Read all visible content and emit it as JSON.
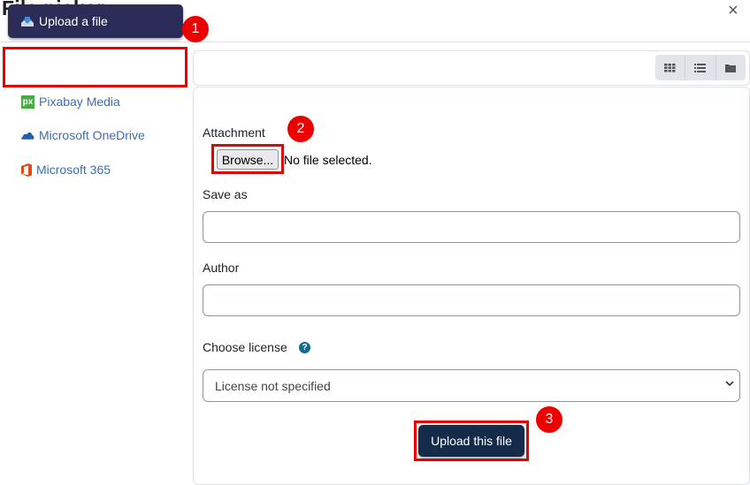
{
  "dialog": {
    "title": "File picker",
    "close_label": "×"
  },
  "sidebar": {
    "items": [
      {
        "label": "Upload a file",
        "icon": "upload-icon",
        "active": true
      },
      {
        "label": "Pixabay Media",
        "icon": "pixabay-icon"
      },
      {
        "label": "Microsoft OneDrive",
        "icon": "onedrive-icon"
      },
      {
        "label": "Microsoft 365",
        "icon": "office-icon"
      }
    ]
  },
  "toolbar": {
    "views": [
      {
        "name": "icons-view",
        "icon": "grid-icon"
      },
      {
        "name": "list-view",
        "icon": "list-icon"
      },
      {
        "name": "tree-view",
        "icon": "folder-icon"
      }
    ]
  },
  "form": {
    "attachment_label": "Attachment",
    "browse_label": "Browse...",
    "no_file_text": "No file selected.",
    "save_as_label": "Save as",
    "save_as_value": "",
    "author_label": "Author",
    "author_value": "",
    "license_label": "Choose license",
    "license_help": "?",
    "license_selected": "License not specified",
    "upload_label": "Upload this file"
  },
  "annotations": {
    "badges": [
      "1",
      "2",
      "3"
    ],
    "highlight_color": "#e60000"
  },
  "colors": {
    "sidebar_active_bg": "#2b2d58",
    "link": "#3a6fb0",
    "primary_button": "#152b4a",
    "help_icon": "#0f6b8a"
  }
}
